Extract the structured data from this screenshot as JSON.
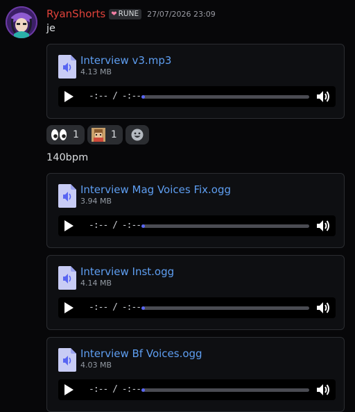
{
  "message": {
    "username": "RyanShorts",
    "role_tag": "RUNE",
    "timestamp": "27/07/2026 23:09",
    "text": "je"
  },
  "second_message": {
    "text": "140bpm"
  },
  "attachments": [
    {
      "name": "Interview v3.mp3",
      "size": "4.13 MB",
      "time": "-:-- / -:--",
      "progress": 0.02
    },
    {
      "name": "Interview Mag Voices Fix.ogg",
      "size": "3.94 MB",
      "time": "-:-- / -:--",
      "progress": 0.02
    },
    {
      "name": "Interview Inst.ogg",
      "size": "4.14 MB",
      "time": "-:-- / -:--",
      "progress": 0.02
    },
    {
      "name": "Interview Bf Voices.ogg",
      "size": "4.03 MB",
      "time": "-:-- / -:--",
      "progress": 0.02
    }
  ],
  "reactions": [
    {
      "emoji": "eyes-emoji",
      "count": "1"
    },
    {
      "emoji": "custom-character-emoji",
      "count": "1"
    }
  ],
  "colors": {
    "background": "#070709",
    "username": "#e0423a",
    "link": "#5e9ef1",
    "accent": "#5865f2"
  }
}
